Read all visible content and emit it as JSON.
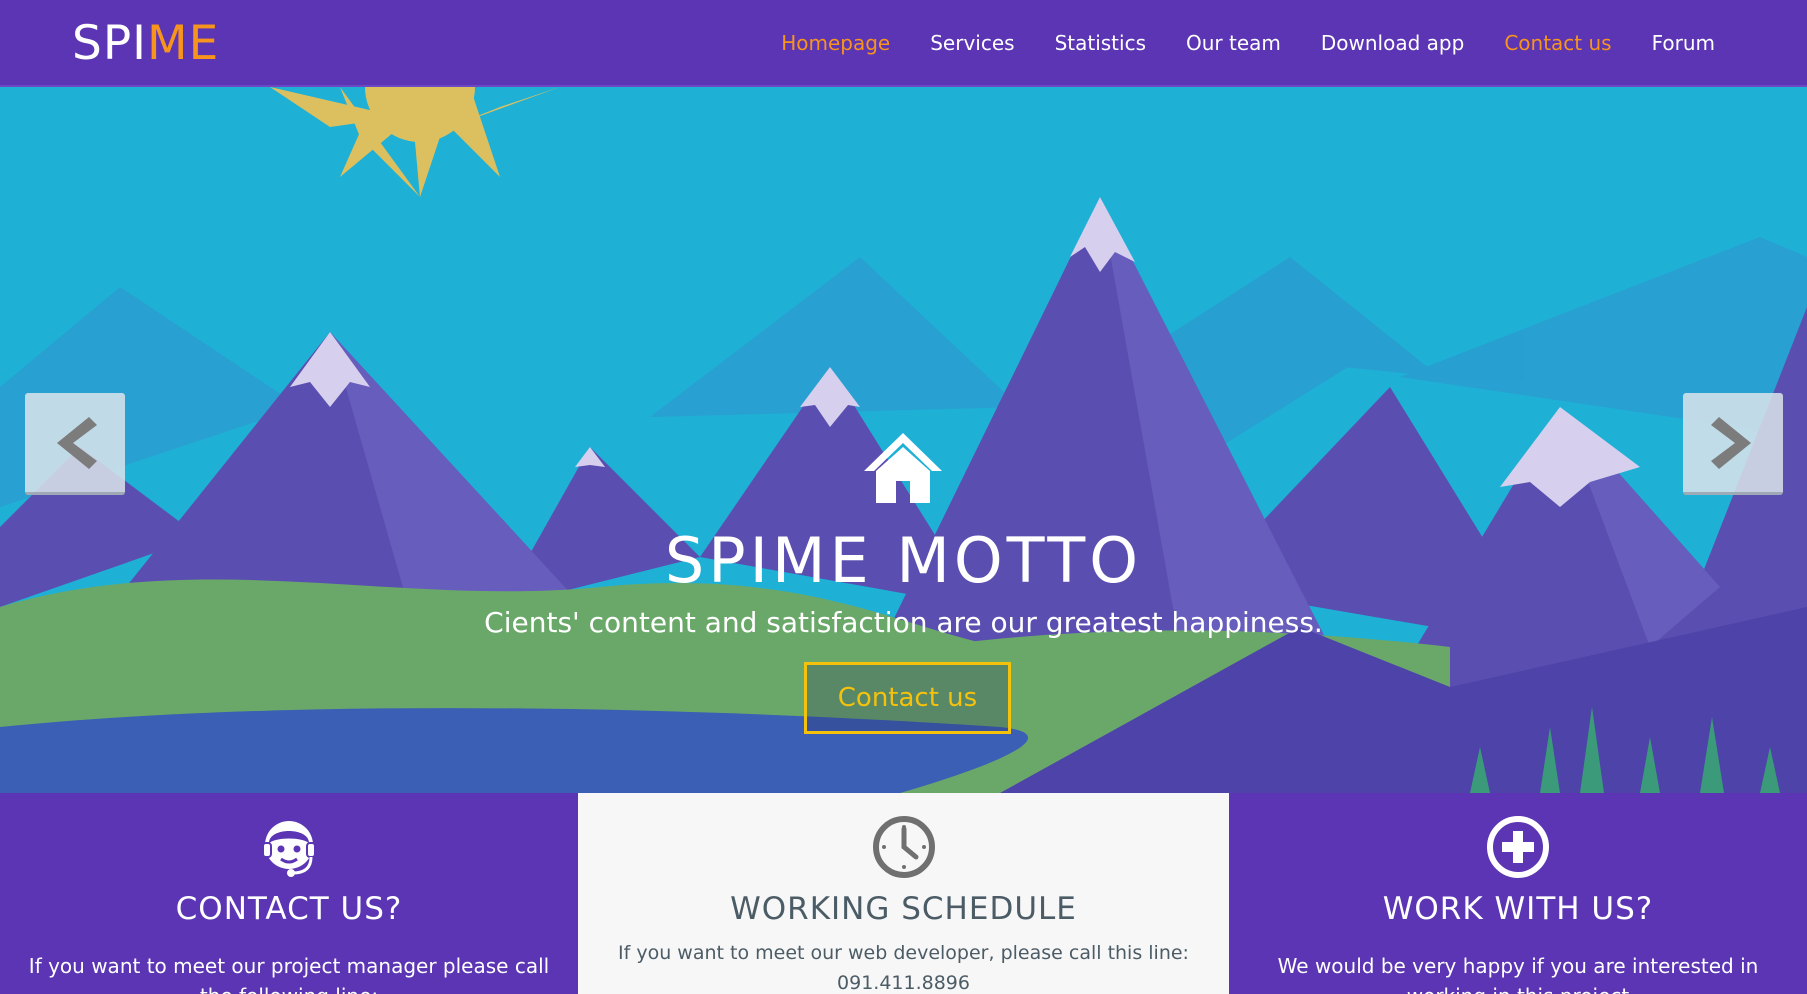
{
  "brand": {
    "part1": "SPI",
    "part2": "ME"
  },
  "nav": {
    "items": [
      {
        "label": "Homepage",
        "accent": true
      },
      {
        "label": "Services",
        "accent": false
      },
      {
        "label": "Statistics",
        "accent": false
      },
      {
        "label": "Our team",
        "accent": false
      },
      {
        "label": "Download app",
        "accent": false
      },
      {
        "label": "Contact us",
        "accent": true
      },
      {
        "label": "Forum",
        "accent": false
      }
    ]
  },
  "hero": {
    "title": "SPIME MOTTO",
    "tagline": "Cients' content and satisfaction are our greatest happiness.",
    "cta_label": "Contact us",
    "icon": "home-icon",
    "prev_icon": "chevron-left-icon",
    "next_icon": "chevron-right-icon"
  },
  "panels": [
    {
      "icon": "headset-support-icon",
      "title": "CONTACT US?",
      "text": "If you want to meet our project manager please call the following line:"
    },
    {
      "icon": "clock-icon",
      "title": "WORKING SCHEDULE",
      "text": "If you want to meet our web developer, please call this line: 091.411.8896"
    },
    {
      "icon": "plus-circle-icon",
      "title": "WORK WITH US?",
      "text": "We would be very happy if you are interested in working in this project"
    }
  ],
  "colors": {
    "brand_purple": "#5b35b3",
    "accent_orange": "#f7941d",
    "cta_yellow": "#f4c20d",
    "sky_blue": "#1fb0d6"
  }
}
